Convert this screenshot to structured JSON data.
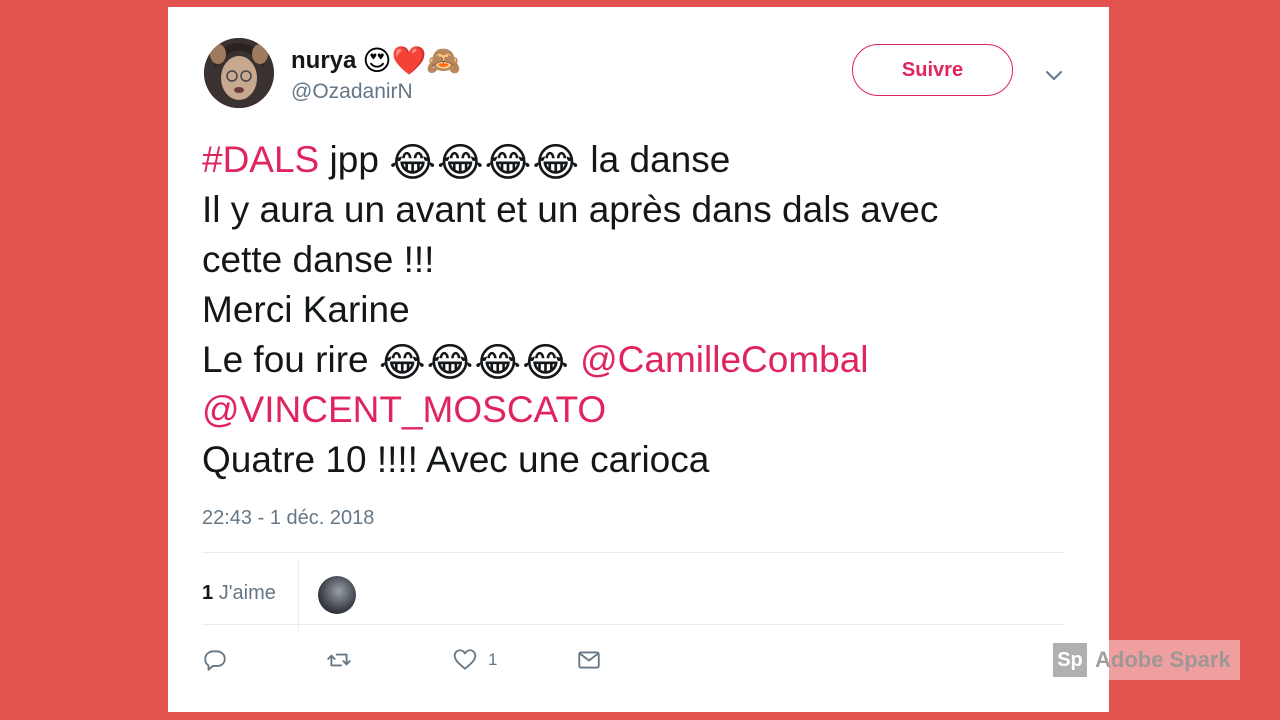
{
  "user": {
    "name": "nurya",
    "name_emoji": "😍❤️🙈",
    "handle": "@OzadanirN"
  },
  "follow_button": {
    "label": "Suivre"
  },
  "tweet": {
    "hashtag": "#DALS",
    "line1_word": "jpp",
    "line1_emoji": "😂😂😂😂",
    "line1_rest": "la danse",
    "line2": "Il y aura un avant et un après dans dals avec",
    "line3": "cette danse !!!",
    "line4": "Merci Karine",
    "line5_text": "Le fou rire",
    "line5_emoji": "😂😂😂😂",
    "mention1": "@CamilleCombal",
    "mention2": "@VINCENT_MOSCATO",
    "line7": "Quatre 10 !!!! Avec une carioca"
  },
  "timestamp": "22:43 - 1 déc. 2018",
  "likes": {
    "count": "1",
    "label": "J'aime"
  },
  "actions": {
    "like_count": "1"
  },
  "watermark": {
    "logo": "Sp",
    "text": "Adobe Spark"
  },
  "colors": {
    "background": "#e2534f",
    "accent": "#e0245e",
    "secondary_text": "#657786"
  }
}
